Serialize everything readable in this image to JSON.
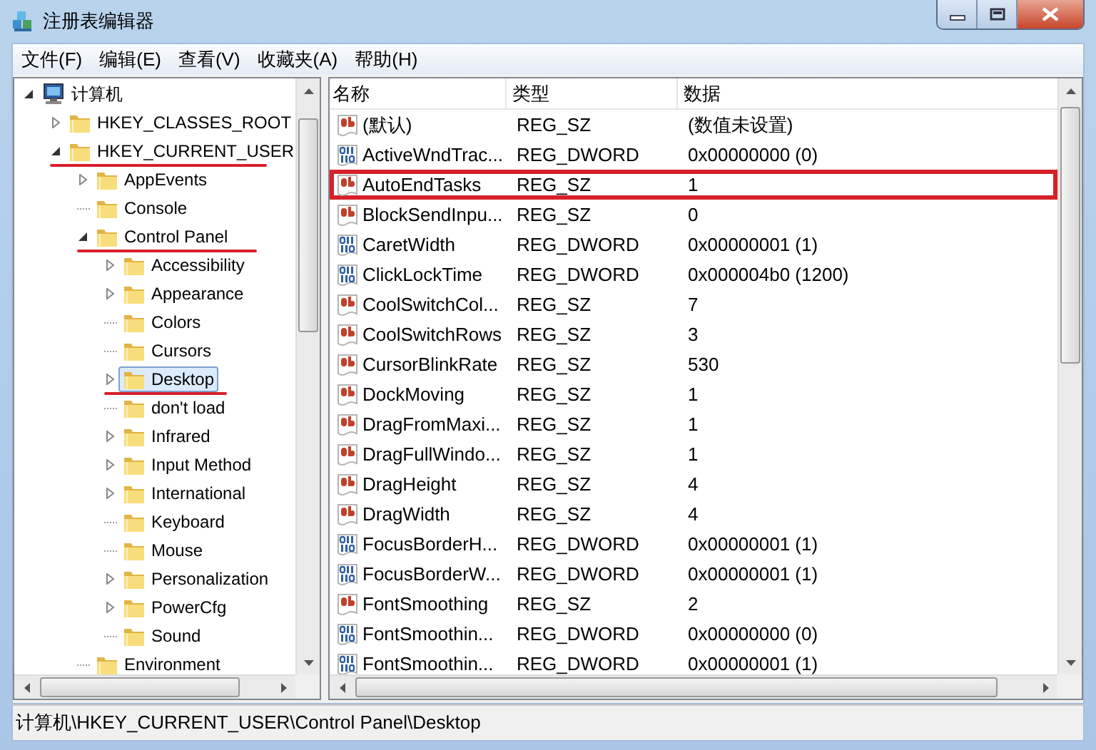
{
  "window": {
    "title": "注册表编辑器"
  },
  "menu": [
    "文件(F)",
    "编辑(E)",
    "查看(V)",
    "收藏夹(A)",
    "帮助(H)"
  ],
  "tree": [
    {
      "label": "计算机",
      "kind": "computer",
      "has_children": true,
      "expanded": true,
      "selected": false,
      "underlined": false,
      "children": [
        {
          "label": "HKEY_CLASSES_ROOT",
          "kind": "folder",
          "has_children": true,
          "expanded": false,
          "selected": false,
          "underlined": false
        },
        {
          "label": "HKEY_CURRENT_USER",
          "kind": "folder",
          "has_children": true,
          "expanded": true,
          "selected": false,
          "underlined": true,
          "children": [
            {
              "label": "AppEvents",
              "kind": "folder",
              "has_children": true,
              "expanded": false,
              "selected": false,
              "underlined": false
            },
            {
              "label": "Console",
              "kind": "folder",
              "has_children": false,
              "expanded": false,
              "selected": false,
              "underlined": false
            },
            {
              "label": "Control Panel",
              "kind": "folder",
              "has_children": true,
              "expanded": true,
              "selected": false,
              "underlined": true,
              "children": [
                {
                  "label": "Accessibility",
                  "kind": "folder",
                  "has_children": true,
                  "expanded": false,
                  "selected": false,
                  "underlined": false
                },
                {
                  "label": "Appearance",
                  "kind": "folder",
                  "has_children": true,
                  "expanded": false,
                  "selected": false,
                  "underlined": false
                },
                {
                  "label": "Colors",
                  "kind": "folder",
                  "has_children": false,
                  "expanded": false,
                  "selected": false,
                  "underlined": false
                },
                {
                  "label": "Cursors",
                  "kind": "folder",
                  "has_children": false,
                  "expanded": false,
                  "selected": false,
                  "underlined": false
                },
                {
                  "label": "Desktop",
                  "kind": "folder",
                  "has_children": true,
                  "expanded": false,
                  "selected": true,
                  "underlined": true
                },
                {
                  "label": "don't load",
                  "kind": "folder",
                  "has_children": false,
                  "expanded": false,
                  "selected": false,
                  "underlined": false
                },
                {
                  "label": "Infrared",
                  "kind": "folder",
                  "has_children": true,
                  "expanded": false,
                  "selected": false,
                  "underlined": false
                },
                {
                  "label": "Input Method",
                  "kind": "folder",
                  "has_children": true,
                  "expanded": false,
                  "selected": false,
                  "underlined": false
                },
                {
                  "label": "International",
                  "kind": "folder",
                  "has_children": true,
                  "expanded": false,
                  "selected": false,
                  "underlined": false
                },
                {
                  "label": "Keyboard",
                  "kind": "folder",
                  "has_children": false,
                  "expanded": false,
                  "selected": false,
                  "underlined": false
                },
                {
                  "label": "Mouse",
                  "kind": "folder",
                  "has_children": false,
                  "expanded": false,
                  "selected": false,
                  "underlined": false
                },
                {
                  "label": "Personalization",
                  "kind": "folder",
                  "has_children": true,
                  "expanded": false,
                  "selected": false,
                  "underlined": false
                },
                {
                  "label": "PowerCfg",
                  "kind": "folder",
                  "has_children": true,
                  "expanded": false,
                  "selected": false,
                  "underlined": false
                },
                {
                  "label": "Sound",
                  "kind": "folder",
                  "has_children": false,
                  "expanded": false,
                  "selected": false,
                  "underlined": false
                }
              ]
            },
            {
              "label": "Environment",
              "kind": "folder",
              "has_children": false,
              "expanded": false,
              "selected": false,
              "underlined": false
            }
          ]
        }
      ]
    }
  ],
  "values": {
    "columns": [
      "名称",
      "类型",
      "数据"
    ],
    "rows": [
      {
        "kind": "sz",
        "name": "(默认)",
        "type": "REG_SZ",
        "data": "(数值未设置)",
        "highlighted": false
      },
      {
        "kind": "dword",
        "name": "ActiveWndTrac...",
        "type": "REG_DWORD",
        "data": "0x00000000 (0)",
        "highlighted": false
      },
      {
        "kind": "sz",
        "name": "AutoEndTasks",
        "type": "REG_SZ",
        "data": "1",
        "highlighted": true
      },
      {
        "kind": "sz",
        "name": "BlockSendInpu...",
        "type": "REG_SZ",
        "data": "0",
        "highlighted": false
      },
      {
        "kind": "dword",
        "name": "CaretWidth",
        "type": "REG_DWORD",
        "data": "0x00000001 (1)",
        "highlighted": false
      },
      {
        "kind": "dword",
        "name": "ClickLockTime",
        "type": "REG_DWORD",
        "data": "0x000004b0 (1200)",
        "highlighted": false
      },
      {
        "kind": "sz",
        "name": "CoolSwitchCol...",
        "type": "REG_SZ",
        "data": "7",
        "highlighted": false
      },
      {
        "kind": "sz",
        "name": "CoolSwitchRows",
        "type": "REG_SZ",
        "data": "3",
        "highlighted": false
      },
      {
        "kind": "sz",
        "name": "CursorBlinkRate",
        "type": "REG_SZ",
        "data": "530",
        "highlighted": false
      },
      {
        "kind": "sz",
        "name": "DockMoving",
        "type": "REG_SZ",
        "data": "1",
        "highlighted": false
      },
      {
        "kind": "sz",
        "name": "DragFromMaxi...",
        "type": "REG_SZ",
        "data": "1",
        "highlighted": false
      },
      {
        "kind": "sz",
        "name": "DragFullWindo...",
        "type": "REG_SZ",
        "data": "1",
        "highlighted": false
      },
      {
        "kind": "sz",
        "name": "DragHeight",
        "type": "REG_SZ",
        "data": "4",
        "highlighted": false
      },
      {
        "kind": "sz",
        "name": "DragWidth",
        "type": "REG_SZ",
        "data": "4",
        "highlighted": false
      },
      {
        "kind": "dword",
        "name": "FocusBorderH...",
        "type": "REG_DWORD",
        "data": "0x00000001 (1)",
        "highlighted": false
      },
      {
        "kind": "dword",
        "name": "FocusBorderW...",
        "type": "REG_DWORD",
        "data": "0x00000001 (1)",
        "highlighted": false
      },
      {
        "kind": "sz",
        "name": "FontSmoothing",
        "type": "REG_SZ",
        "data": "2",
        "highlighted": false
      },
      {
        "kind": "dword",
        "name": "FontSmoothin...",
        "type": "REG_DWORD",
        "data": "0x00000000 (0)",
        "highlighted": false
      },
      {
        "kind": "dword",
        "name": "FontSmoothin...",
        "type": "REG_DWORD",
        "data": "0x00000001 (1)",
        "highlighted": false
      }
    ]
  },
  "status_bar": "计算机\\HKEY_CURRENT_USER\\Control Panel\\Desktop"
}
